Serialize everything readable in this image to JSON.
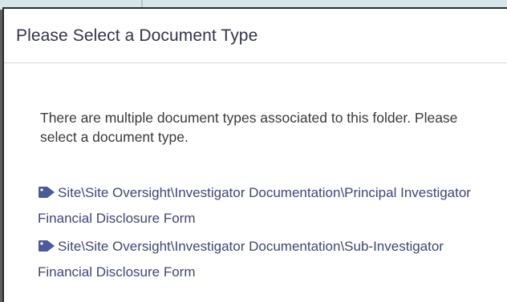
{
  "dialog": {
    "title": "Please Select a Document Type",
    "message": "There are multiple document types associated to this folder. Please select a document type.",
    "items": [
      {
        "icon": "tag-icon",
        "label": "Site\\Site Oversight\\Investigator Documentation\\Principal Investigator Financial Disclosure Form"
      },
      {
        "icon": "tag-icon",
        "label": "Site\\Site Oversight\\Investigator Documentation\\Sub-Investigator Financial Disclosure Form"
      }
    ]
  },
  "colors": {
    "title": "#33334d",
    "link": "#3f4676",
    "tag_icon": "#4a5a9a",
    "overlay": "#5f5f5f",
    "backdrop": "#d7e4ea"
  }
}
